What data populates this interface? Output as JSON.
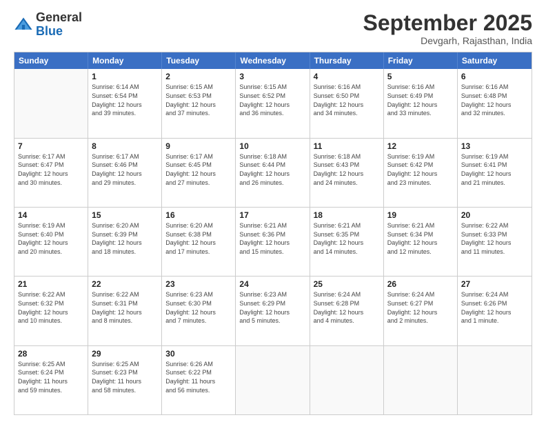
{
  "logo": {
    "general": "General",
    "blue": "Blue"
  },
  "title": "September 2025",
  "subtitle": "Devgarh, Rajasthan, India",
  "days": [
    "Sunday",
    "Monday",
    "Tuesday",
    "Wednesday",
    "Thursday",
    "Friday",
    "Saturday"
  ],
  "weeks": [
    [
      {
        "day": "",
        "info": ""
      },
      {
        "day": "1",
        "info": "Sunrise: 6:14 AM\nSunset: 6:54 PM\nDaylight: 12 hours\nand 39 minutes."
      },
      {
        "day": "2",
        "info": "Sunrise: 6:15 AM\nSunset: 6:53 PM\nDaylight: 12 hours\nand 37 minutes."
      },
      {
        "day": "3",
        "info": "Sunrise: 6:15 AM\nSunset: 6:52 PM\nDaylight: 12 hours\nand 36 minutes."
      },
      {
        "day": "4",
        "info": "Sunrise: 6:16 AM\nSunset: 6:50 PM\nDaylight: 12 hours\nand 34 minutes."
      },
      {
        "day": "5",
        "info": "Sunrise: 6:16 AM\nSunset: 6:49 PM\nDaylight: 12 hours\nand 33 minutes."
      },
      {
        "day": "6",
        "info": "Sunrise: 6:16 AM\nSunset: 6:48 PM\nDaylight: 12 hours\nand 32 minutes."
      }
    ],
    [
      {
        "day": "7",
        "info": "Sunrise: 6:17 AM\nSunset: 6:47 PM\nDaylight: 12 hours\nand 30 minutes."
      },
      {
        "day": "8",
        "info": "Sunrise: 6:17 AM\nSunset: 6:46 PM\nDaylight: 12 hours\nand 29 minutes."
      },
      {
        "day": "9",
        "info": "Sunrise: 6:17 AM\nSunset: 6:45 PM\nDaylight: 12 hours\nand 27 minutes."
      },
      {
        "day": "10",
        "info": "Sunrise: 6:18 AM\nSunset: 6:44 PM\nDaylight: 12 hours\nand 26 minutes."
      },
      {
        "day": "11",
        "info": "Sunrise: 6:18 AM\nSunset: 6:43 PM\nDaylight: 12 hours\nand 24 minutes."
      },
      {
        "day": "12",
        "info": "Sunrise: 6:19 AM\nSunset: 6:42 PM\nDaylight: 12 hours\nand 23 minutes."
      },
      {
        "day": "13",
        "info": "Sunrise: 6:19 AM\nSunset: 6:41 PM\nDaylight: 12 hours\nand 21 minutes."
      }
    ],
    [
      {
        "day": "14",
        "info": "Sunrise: 6:19 AM\nSunset: 6:40 PM\nDaylight: 12 hours\nand 20 minutes."
      },
      {
        "day": "15",
        "info": "Sunrise: 6:20 AM\nSunset: 6:39 PM\nDaylight: 12 hours\nand 18 minutes."
      },
      {
        "day": "16",
        "info": "Sunrise: 6:20 AM\nSunset: 6:38 PM\nDaylight: 12 hours\nand 17 minutes."
      },
      {
        "day": "17",
        "info": "Sunrise: 6:21 AM\nSunset: 6:36 PM\nDaylight: 12 hours\nand 15 minutes."
      },
      {
        "day": "18",
        "info": "Sunrise: 6:21 AM\nSunset: 6:35 PM\nDaylight: 12 hours\nand 14 minutes."
      },
      {
        "day": "19",
        "info": "Sunrise: 6:21 AM\nSunset: 6:34 PM\nDaylight: 12 hours\nand 12 minutes."
      },
      {
        "day": "20",
        "info": "Sunrise: 6:22 AM\nSunset: 6:33 PM\nDaylight: 12 hours\nand 11 minutes."
      }
    ],
    [
      {
        "day": "21",
        "info": "Sunrise: 6:22 AM\nSunset: 6:32 PM\nDaylight: 12 hours\nand 10 minutes."
      },
      {
        "day": "22",
        "info": "Sunrise: 6:22 AM\nSunset: 6:31 PM\nDaylight: 12 hours\nand 8 minutes."
      },
      {
        "day": "23",
        "info": "Sunrise: 6:23 AM\nSunset: 6:30 PM\nDaylight: 12 hours\nand 7 minutes."
      },
      {
        "day": "24",
        "info": "Sunrise: 6:23 AM\nSunset: 6:29 PM\nDaylight: 12 hours\nand 5 minutes."
      },
      {
        "day": "25",
        "info": "Sunrise: 6:24 AM\nSunset: 6:28 PM\nDaylight: 12 hours\nand 4 minutes."
      },
      {
        "day": "26",
        "info": "Sunrise: 6:24 AM\nSunset: 6:27 PM\nDaylight: 12 hours\nand 2 minutes."
      },
      {
        "day": "27",
        "info": "Sunrise: 6:24 AM\nSunset: 6:26 PM\nDaylight: 12 hours\nand 1 minute."
      }
    ],
    [
      {
        "day": "28",
        "info": "Sunrise: 6:25 AM\nSunset: 6:24 PM\nDaylight: 11 hours\nand 59 minutes."
      },
      {
        "day": "29",
        "info": "Sunrise: 6:25 AM\nSunset: 6:23 PM\nDaylight: 11 hours\nand 58 minutes."
      },
      {
        "day": "30",
        "info": "Sunrise: 6:26 AM\nSunset: 6:22 PM\nDaylight: 11 hours\nand 56 minutes."
      },
      {
        "day": "",
        "info": ""
      },
      {
        "day": "",
        "info": ""
      },
      {
        "day": "",
        "info": ""
      },
      {
        "day": "",
        "info": ""
      }
    ]
  ]
}
